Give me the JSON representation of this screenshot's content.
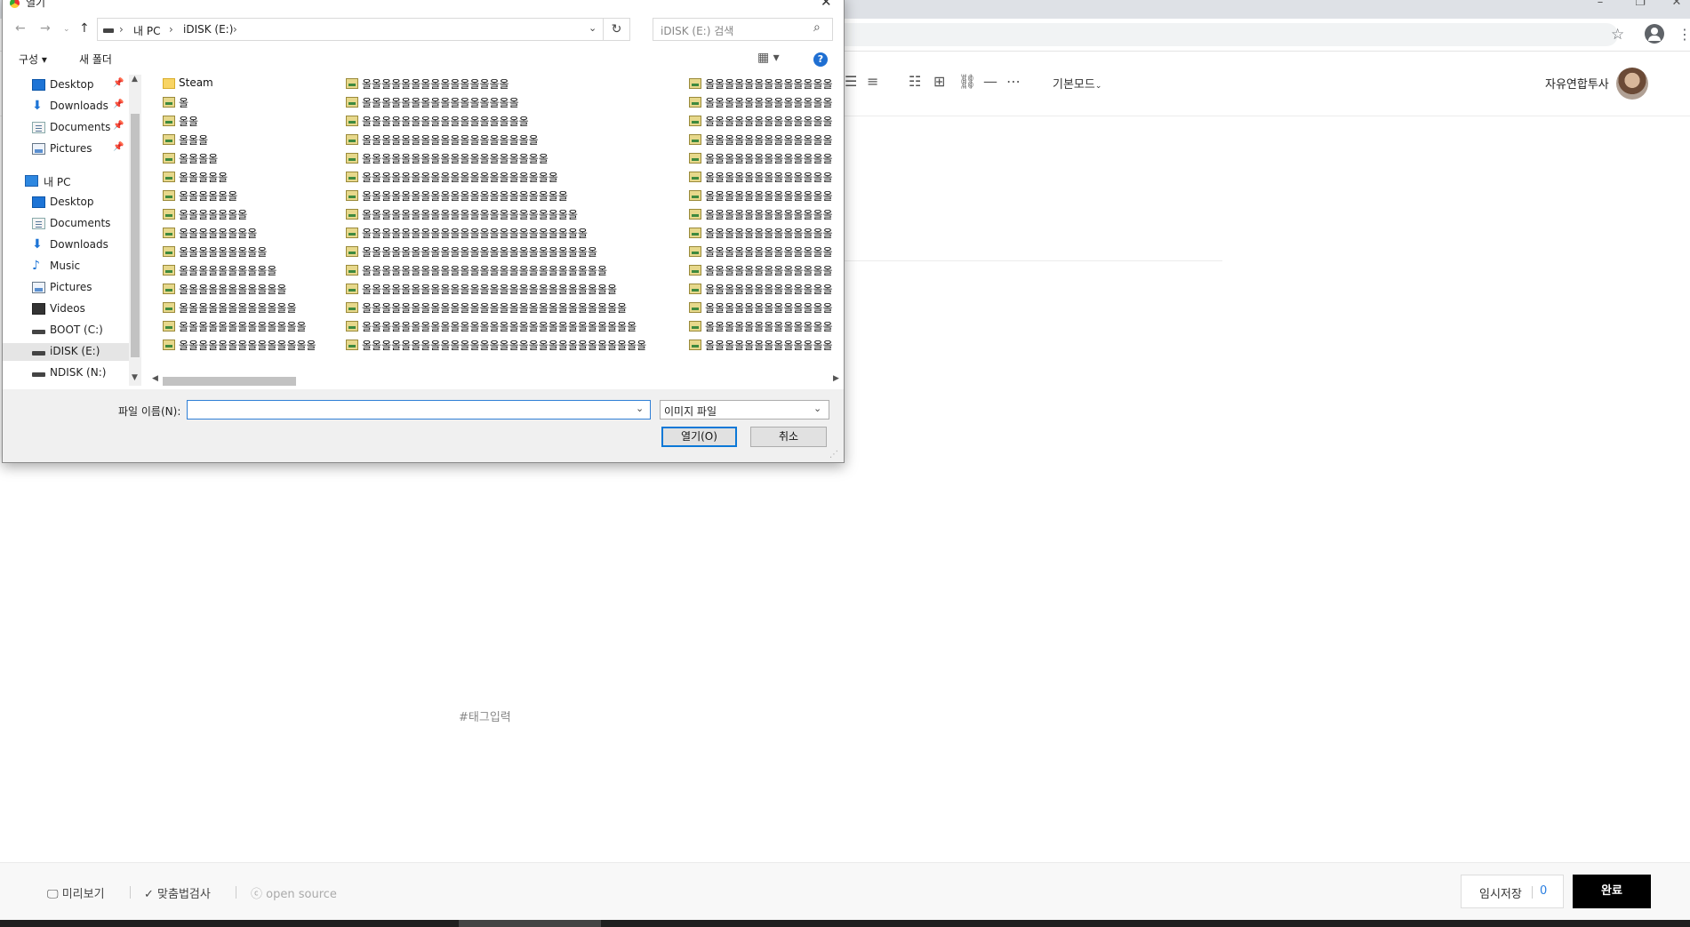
{
  "browser": {
    "window_controls": [
      "–",
      "❐",
      "✕"
    ],
    "star_icon": "☆",
    "menu_icon": "⋮"
  },
  "editor": {
    "toolbar_icons": [
      "align-right-icon",
      "align-justify-icon",
      "bulleted-list-icon",
      "table-icon",
      "link-icon",
      "horizontal-rule-icon",
      "more-icon"
    ],
    "mode_label": "기본모드",
    "username": "자유연합투사",
    "tag_placeholder": "#태그입력"
  },
  "bottom_bar": {
    "preview_label": "미리보기",
    "spellcheck_label": "맞춤법검사",
    "opensource_label": "open source",
    "draft_label": "임시저장",
    "draft_count": "0",
    "done_label": "완료"
  },
  "dialog": {
    "title": "열기",
    "close": "✕",
    "breadcrumb": [
      "내 PC",
      "iDISK (E:)"
    ],
    "search_placeholder": "iDISK (E:) 검색",
    "organize_label": "구성 ▾",
    "new_folder_label": "새 폴더",
    "help": "?",
    "nav_items": [
      {
        "label": "Desktop",
        "icon": "desktop",
        "pinned": true
      },
      {
        "label": "Downloads",
        "icon": "download",
        "pinned": true
      },
      {
        "label": "Documents",
        "icon": "docs",
        "pinned": true
      },
      {
        "label": "Pictures",
        "icon": "pics",
        "pinned": true
      },
      {
        "label": "내 PC",
        "icon": "pc",
        "pinned": false
      },
      {
        "label": "Desktop",
        "icon": "desktop",
        "pinned": false
      },
      {
        "label": "Documents",
        "icon": "docs",
        "pinned": false
      },
      {
        "label": "Downloads",
        "icon": "download",
        "pinned": false
      },
      {
        "label": "Music",
        "icon": "music",
        "pinned": false
      },
      {
        "label": "Pictures",
        "icon": "pics",
        "pinned": false
      },
      {
        "label": "Videos",
        "icon": "videos",
        "pinned": false
      },
      {
        "label": "BOOT (C:)",
        "icon": "drive",
        "pinned": false
      },
      {
        "label": "iDISK (E:)",
        "icon": "drive",
        "pinned": false,
        "selected": true
      },
      {
        "label": "NDISK (N:)",
        "icon": "drive",
        "pinned": false
      }
    ],
    "pin_glyph": "📌",
    "files_col1": [
      "Steam",
      "올",
      "올올",
      "올올올",
      "올올올올",
      "올올올올올",
      "올올올올올올",
      "올올올올올올올",
      "올올올올올올올올",
      "올올올올올올올올올",
      "올올올올올올올올올올",
      "올올올올올올올올올올올",
      "올올올올올올올올올올올올",
      "올올올올올올올올올올올올올",
      "올올올올올올올올올올올올올올"
    ],
    "files_col2": [
      "올올올올올올올올올올올올올올올",
      "올올올올올올올올올올올올올올올올",
      "올올올올올올올올올올올올올올올올올",
      "올올올올올올올올올올올올올올올올올올",
      "올올올올올올올올올올올올올올올올올올올",
      "올올올올올올올올올올올올올올올올올올올올",
      "올올올올올올올올올올올올올올올올올올올올올",
      "올올올올올올올올올올올올올올올올올올올올올올",
      "올올올올올올올올올올올올올올올올올올올올올올올",
      "올올올올올올올올올올올올올올올올올올올올올올올올",
      "올올올올올올올올올올올올올올올올올올올올올올올올올",
      "올올올올올올올올올올올올올올올올올올올올올올올올올올",
      "올올올올올올올올올올올올올올올올올올올올올올올올올올올",
      "올올올올올올올올올올올올올올올올올올올올올올올올올올올올",
      "올올올올올올올올올올올올올올올올올올올올올올올올올올올올올"
    ],
    "files_col3": [
      "올올올올올올올올올올올올올",
      "올올올올올올올올올올올올올",
      "올올올올올올올올올올올올올",
      "올올올올올올올올올올올올올",
      "올올올올올올올올올올올올올",
      "올올올올올올올올올올올올올",
      "올올올올올올올올올올올올올",
      "올올올올올올올올올올올올올",
      "올올올올올올올올올올올올올",
      "올올올올올올올올올올올올올",
      "올올올올올올올올올올올올올",
      "올올올올올올올올올올올올올",
      "올올올올올올올올올올올올올",
      "올올올올올올올올올올올올올",
      "올올올올올올올올올올올올올"
    ],
    "filename_label": "파일 이름(N):",
    "filename_value": "",
    "filetype_value": "이미지 파일",
    "open_label": "열기(O)",
    "cancel_label": "취소"
  }
}
